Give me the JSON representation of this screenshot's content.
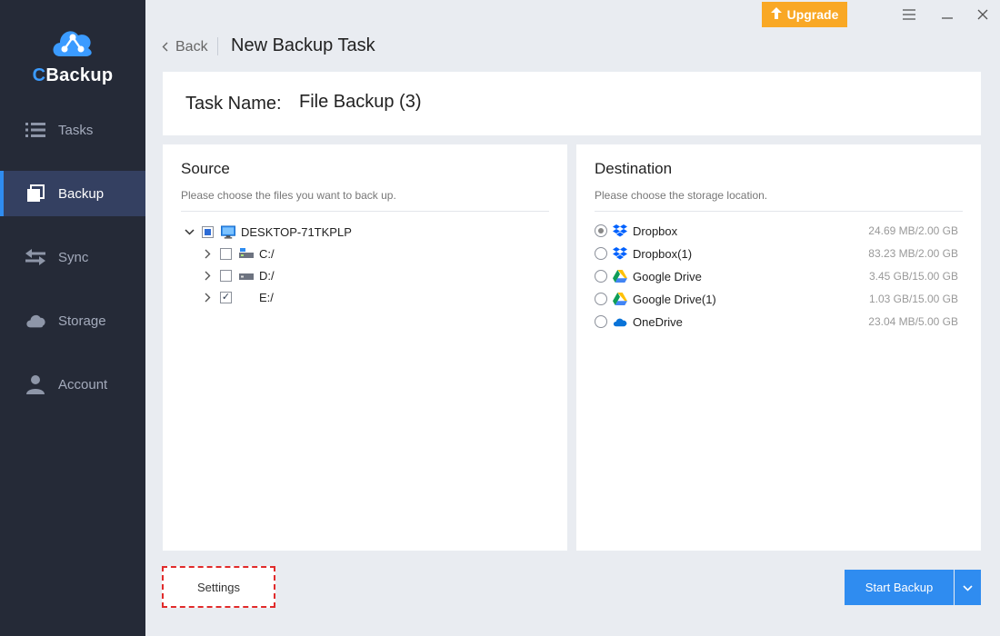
{
  "app": {
    "name_prefix": "C",
    "name_rest": "Backup"
  },
  "colors": {
    "sidebar_bg": "#252a37",
    "sidebar_active": "#344061",
    "accent": "#2f8cf0",
    "upgrade": "#f9a825",
    "highlight": "#e12b2b"
  },
  "nav": {
    "items": [
      {
        "label": "Tasks",
        "icon": "list-icon",
        "active": false
      },
      {
        "label": "Backup",
        "icon": "backup-icon",
        "active": true
      },
      {
        "label": "Sync",
        "icon": "sync-icon",
        "active": false
      },
      {
        "label": "Storage",
        "icon": "cloud-icon",
        "active": false
      },
      {
        "label": "Account",
        "icon": "user-icon",
        "active": false
      }
    ]
  },
  "window": {
    "upgrade_label": "Upgrade"
  },
  "header": {
    "back_label": "Back",
    "title": "New Backup Task"
  },
  "task": {
    "label": "Task Name:",
    "value": "File Backup (3)"
  },
  "source": {
    "title": "Source",
    "hint": "Please choose the files you want to back up.",
    "root": {
      "label": "DESKTOP-71TKPLP",
      "state": "partial",
      "expanded": true
    },
    "drives": [
      {
        "label": "C:/",
        "checked": false,
        "icon": "system-drive-icon"
      },
      {
        "label": "D:/",
        "checked": false,
        "icon": "drive-icon"
      },
      {
        "label": "E:/",
        "checked": true,
        "icon": "blank-drive-icon"
      }
    ]
  },
  "destination": {
    "title": "Destination",
    "hint": "Please choose the storage location.",
    "items": [
      {
        "name": "Dropbox",
        "size": "24.69 MB/2.00 GB",
        "icon": "dropbox-icon",
        "selected": true
      },
      {
        "name": "Dropbox(1)",
        "size": "83.23 MB/2.00 GB",
        "icon": "dropbox-icon",
        "selected": false
      },
      {
        "name": "Google Drive",
        "size": "3.45 GB/15.00 GB",
        "icon": "google-drive-icon",
        "selected": false
      },
      {
        "name": "Google Drive(1)",
        "size": "1.03 GB/15.00 GB",
        "icon": "google-drive-icon",
        "selected": false
      },
      {
        "name": "OneDrive",
        "size": "23.04 MB/5.00 GB",
        "icon": "onedrive-icon",
        "selected": false
      }
    ]
  },
  "footer": {
    "settings_label": "Settings",
    "start_label": "Start Backup"
  }
}
